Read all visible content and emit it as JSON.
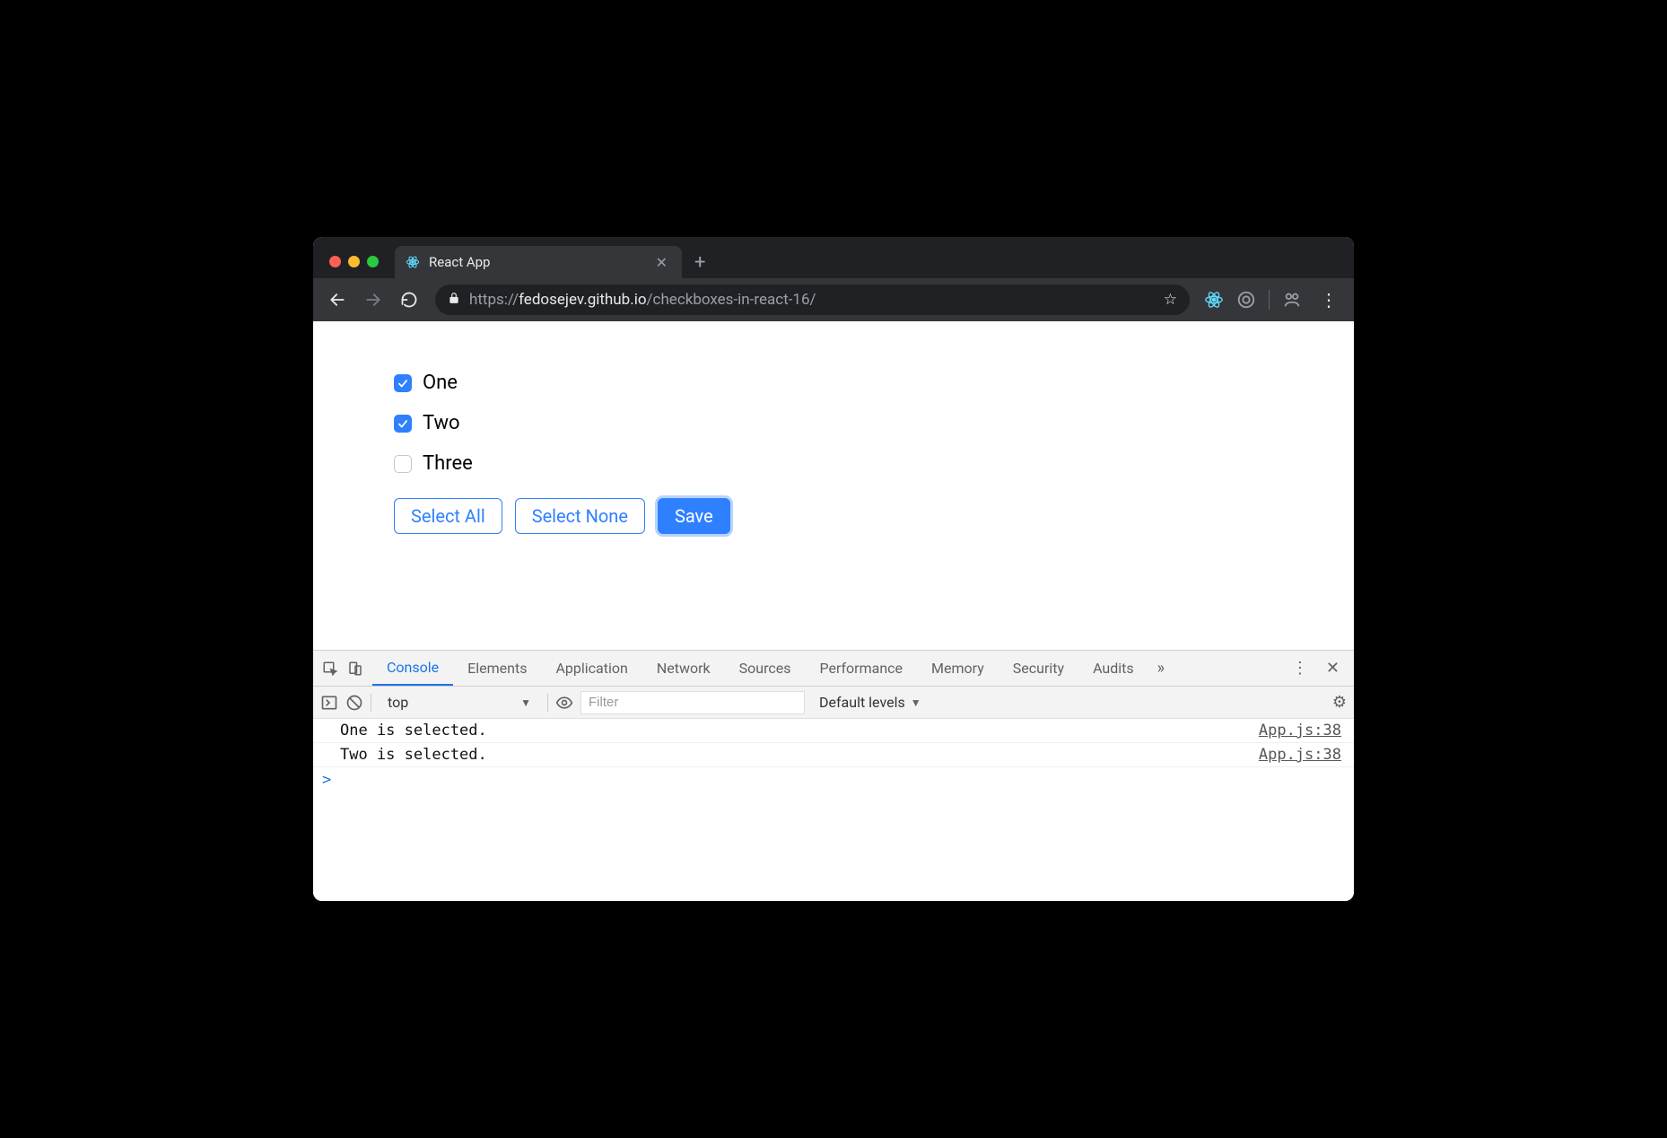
{
  "browser": {
    "tab_title": "React App",
    "url_scheme": "https://",
    "url_host": "fedosejev.github.io",
    "url_path": "/checkboxes-in-react-16/"
  },
  "page": {
    "checkboxes": [
      {
        "label": "One",
        "checked": true
      },
      {
        "label": "Two",
        "checked": true
      },
      {
        "label": "Three",
        "checked": false
      }
    ],
    "buttons": {
      "select_all": "Select All",
      "select_none": "Select None",
      "save": "Save"
    }
  },
  "devtools": {
    "tabs": [
      "Console",
      "Elements",
      "Application",
      "Network",
      "Sources",
      "Performance",
      "Memory",
      "Security",
      "Audits"
    ],
    "active_tab": "Console",
    "context": "top",
    "filter_placeholder": "Filter",
    "levels_label": "Default levels",
    "logs": [
      {
        "message": "One is selected.",
        "source": "App.js:38"
      },
      {
        "message": "Two is selected.",
        "source": "App.js:38"
      }
    ],
    "prompt": ">"
  }
}
